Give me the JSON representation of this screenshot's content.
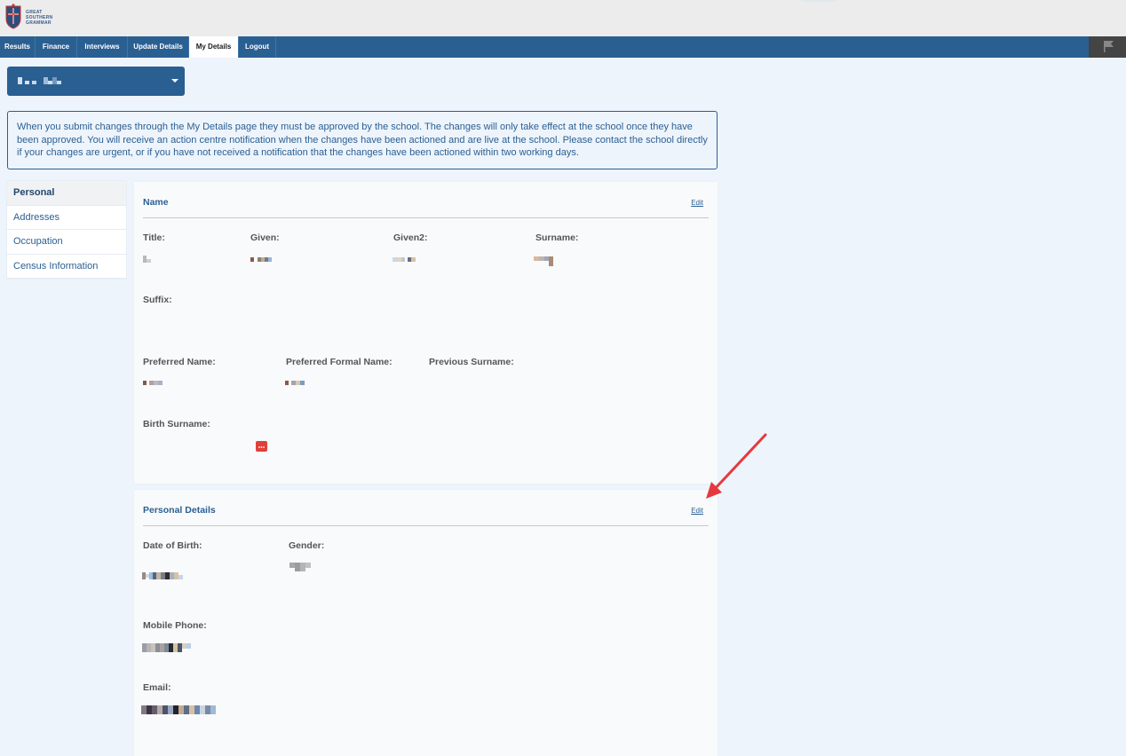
{
  "brand": {
    "logo_lines": [
      "GREAT",
      "SOUTHERN",
      "GRAMMAR"
    ]
  },
  "nav": {
    "tabs": [
      {
        "label": "Results"
      },
      {
        "label": "Finance"
      },
      {
        "label": "Interviews"
      },
      {
        "label": "Update Details"
      },
      {
        "label": "My Details",
        "active": true
      },
      {
        "label": "Logout"
      }
    ]
  },
  "notice": "When you submit changes through the My Details page they must be approved by the school. The changes will only take effect at the school once they have been approved. You will receive an action centre notification when the changes have been actioned and are live at the school. Please contact the school directly if your changes are urgent, or if you have not received a notification that the changes have been actioned within two working days.",
  "sidebar": {
    "items": [
      {
        "label": "Personal",
        "active": true
      },
      {
        "label": "Addresses"
      },
      {
        "label": "Occupation"
      },
      {
        "label": "Census Information"
      }
    ]
  },
  "name_card": {
    "title": "Name",
    "edit_label": "Edit",
    "labels": {
      "title": "Title:",
      "given": "Given:",
      "given2": "Given2:",
      "surname": "Surname:",
      "suffix": "Suffix:",
      "preferred_name": "Preferred Name:",
      "preferred_formal_name": "Preferred Formal Name:",
      "previous_surname": "Previous Surname:",
      "birth_surname": "Birth Surname:"
    }
  },
  "personal_card": {
    "title": "Personal Details",
    "edit_label": "Edit",
    "labels": {
      "dob": "Date of Birth:",
      "gender": "Gender:",
      "mobile": "Mobile Phone:",
      "email": "Email:"
    }
  },
  "colors": {
    "primary": "#2a5f92",
    "background": "#eef4fc",
    "arrow": "#e5393e"
  }
}
